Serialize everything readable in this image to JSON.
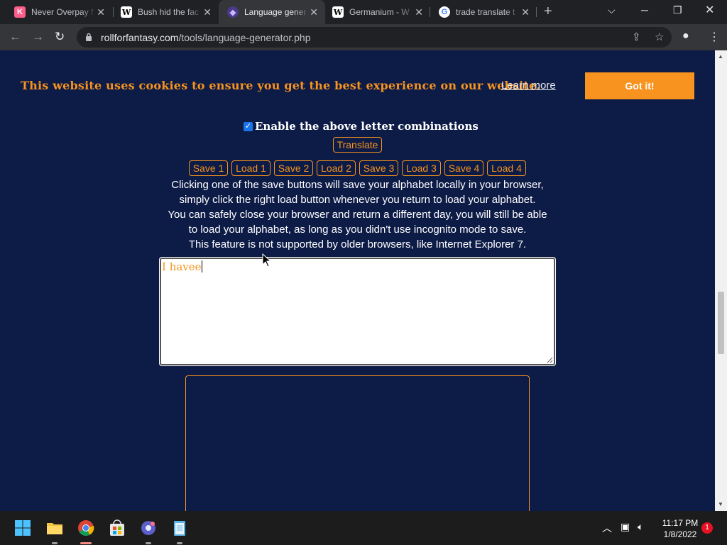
{
  "browser": {
    "tabs": [
      {
        "title": "Never Overpay f",
        "favicon": "K",
        "favicon_color": "#ff5c8a",
        "active": false
      },
      {
        "title": "Bush hid the fac",
        "favicon": "W",
        "favicon_color": "#ffffff",
        "active": false
      },
      {
        "title": "Language gener",
        "favicon": "dice-icon",
        "favicon_color": "#4b3a8c",
        "active": true
      },
      {
        "title": "Germanium - W",
        "favicon": "W",
        "favicon_color": "#ffffff",
        "active": false
      },
      {
        "title": "trade translate t",
        "favicon": "G",
        "favicon_color": "#ffffff",
        "active": false
      }
    ],
    "url_host": "rollforfantasy.com",
    "url_path": "/tools/language-generator.php"
  },
  "cookie_banner": {
    "message": "This website uses cookies to ensure you get the best experience on our website.",
    "learn_more": "Learn more",
    "accept": "Got it!"
  },
  "generator": {
    "enable_label": "Enable the above letter combinations",
    "enable_checked": true,
    "translate_label": "Translate",
    "slot_buttons": [
      "Save 1",
      "Load 1",
      "Save 2",
      "Load 2",
      "Save 3",
      "Load 3",
      "Save 4",
      "Load 4"
    ],
    "info_lines": [
      "Clicking one of the save buttons will save your alphabet locally in your browser,",
      "simply click the right load button whenever you return to load your alphabet.",
      "You can safely close your browser and return a different day, you will still be able",
      "to load your alphabet, as long as you didn't use incognito mode to save.",
      "This feature is not supported by older browsers, like Internet Explorer 7."
    ],
    "input_value": "I havee",
    "output_value": ""
  },
  "taskbar": {
    "time": "11:17 PM",
    "date": "1/8/2022",
    "notification_count": "1"
  },
  "colors": {
    "page_bg": "#0d1b47",
    "accent": "#f7931e"
  }
}
